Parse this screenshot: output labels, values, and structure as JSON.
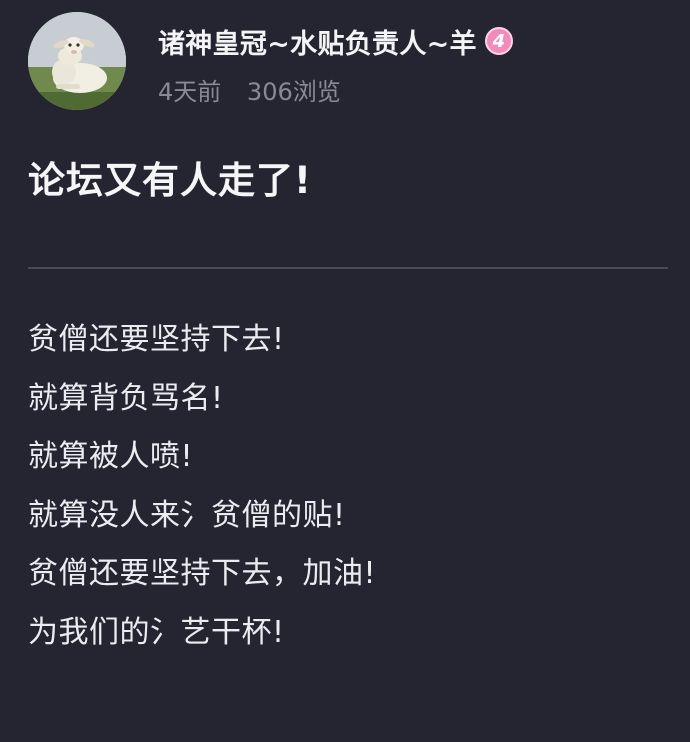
{
  "author": {
    "name": "诸神皇冠~水贴负责人~羊",
    "level": "4",
    "avatar_icon": "lamb-avatar"
  },
  "meta": {
    "time": "4天前",
    "views": "306浏览"
  },
  "post": {
    "title": "论坛又有人走了!",
    "lines": [
      "贫僧还要坚持下去!",
      "就算背负骂名!",
      "就算被人喷!",
      "就算没人来氵贫僧的贴!",
      "贫僧还要坚持下去，加油!",
      "为我们的氵艺干杯!"
    ]
  },
  "colors": {
    "background": "#252531",
    "badge": "#f28bbb",
    "meta_text": "#8a8a96",
    "divider": "#4a4a56"
  }
}
